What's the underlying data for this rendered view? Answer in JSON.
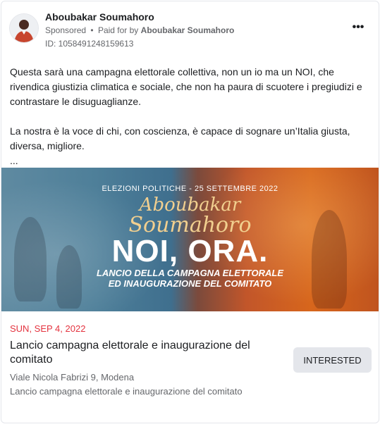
{
  "ad": {
    "advertiser_name": "Aboubakar Soumahoro",
    "sponsored_label": "Sponsored",
    "separator": "•",
    "paid_for_by_label": "Paid for by",
    "paid_for_by_name": "Aboubakar Soumahoro",
    "ad_id": "ID: 1058491248159613",
    "more_icon": "more-options-icon",
    "more_glyph": "•••"
  },
  "body": {
    "paragraph_1": "Questa sarà una campagna elettorale collettiva, non un io ma un NOI, che rivendica giustizia climatica e sociale, che non ha paura di scuotere i pregiudizi e contrastare le disuguaglianze.",
    "paragraph_2": "La nostra è la voce di chi, con coscienza, è capace di sognare un’Italia giusta, diversa, migliore.",
    "truncation": "..."
  },
  "banner": {
    "subtitle": "ELEZIONI POLITICHE - 25 SETTEMBRE 2022",
    "name_line_1": "Aboubakar",
    "name_line_2": "Soumahoro",
    "headline": "NOI, ORA.",
    "line_1": "LANCIO DELLA CAMPAGNA ELETTORALE",
    "line_2": "ED INAUGURAZIONE DEL COMITATO",
    "colors": {
      "left_tint": "#4e7f99",
      "right_tint": "#d7661c",
      "name_color": "#f1cf8f"
    }
  },
  "event": {
    "date": "SUN, SEP 4, 2022",
    "title": "Lancio campagna elettorale e inaugurazione del comitato",
    "interested_label": "INTERESTED",
    "address": "Viale Nicola Fabrizi 9, Modena",
    "description": "Lancio campagna elettorale e inaugurazione del comitato",
    "date_color": "#e4333f"
  }
}
